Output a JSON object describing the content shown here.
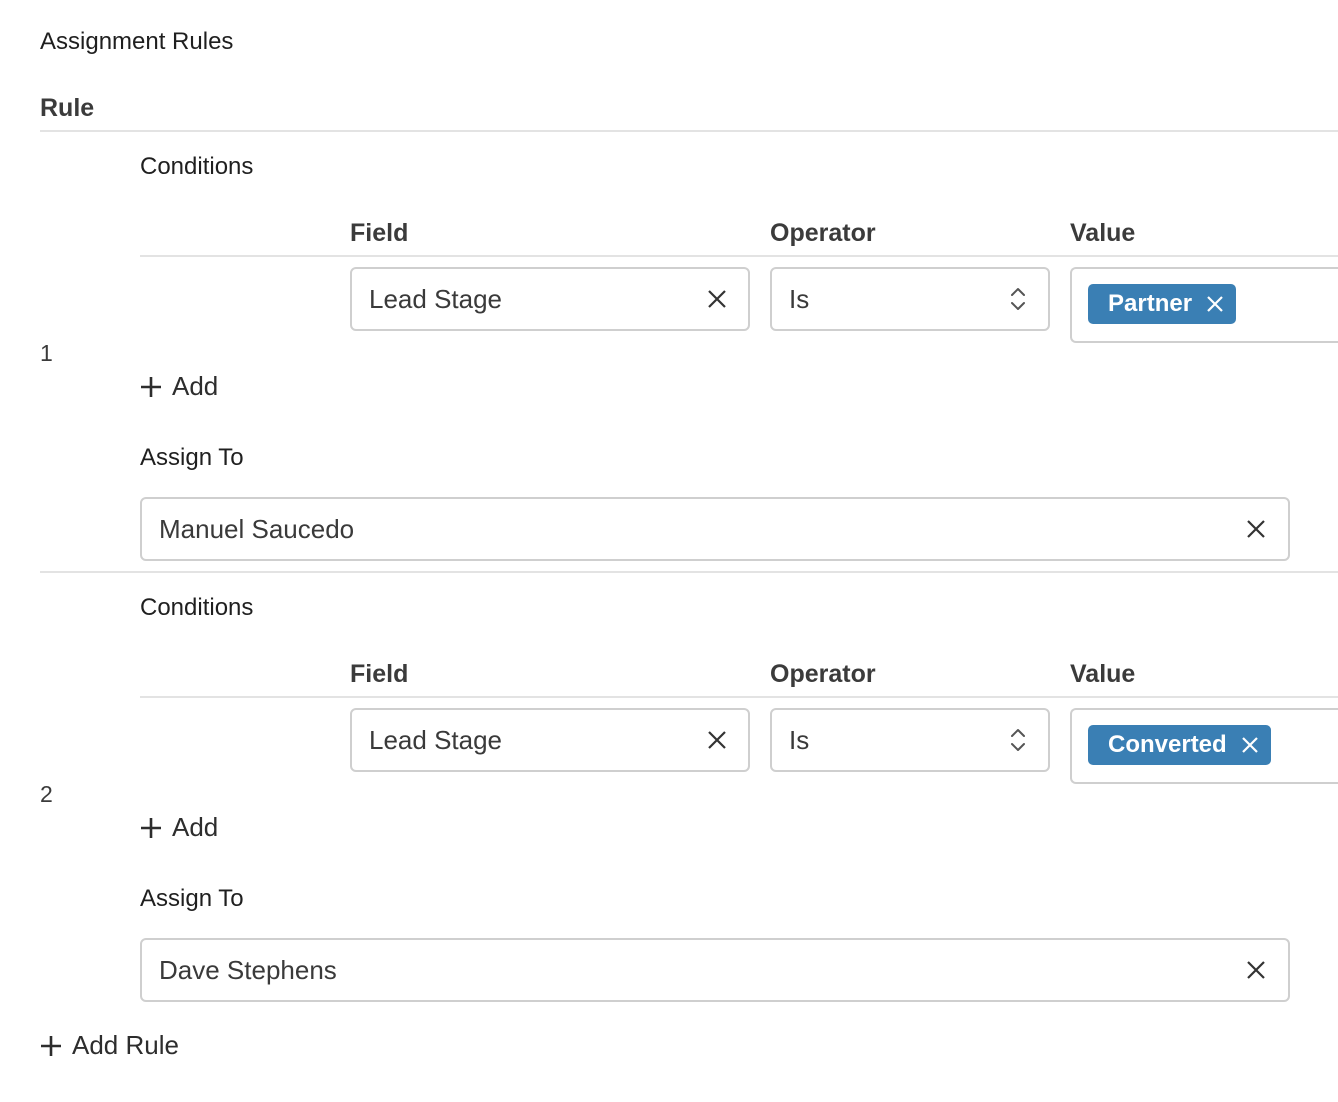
{
  "page": {
    "title": "Assignment Rules"
  },
  "table": {
    "rule_header": "Rule"
  },
  "rules": [
    {
      "number": "1",
      "conditions_label": "Conditions",
      "columns": {
        "field": "Field",
        "operator": "Operator",
        "value": "Value"
      },
      "condition": {
        "field": "Lead Stage",
        "operator": "Is",
        "value_tag": "Partner"
      },
      "add_label": "Add",
      "assign_to_label": "Assign To",
      "assignee": "Manuel Saucedo"
    },
    {
      "number": "2",
      "conditions_label": "Conditions",
      "columns": {
        "field": "Field",
        "operator": "Operator",
        "value": "Value"
      },
      "condition": {
        "field": "Lead Stage",
        "operator": "Is",
        "value_tag": "Converted"
      },
      "add_label": "Add",
      "assign_to_label": "Assign To",
      "assignee": "Dave Stephens"
    }
  ],
  "add_rule_label": "Add Rule",
  "icons": {
    "clear": "close-icon",
    "select": "chevron-up-down-icon",
    "add": "plus-icon"
  },
  "colors": {
    "tag_bg": "#3a7fb4",
    "border": "#cfcfcf",
    "divider": "#e3e3e3"
  }
}
